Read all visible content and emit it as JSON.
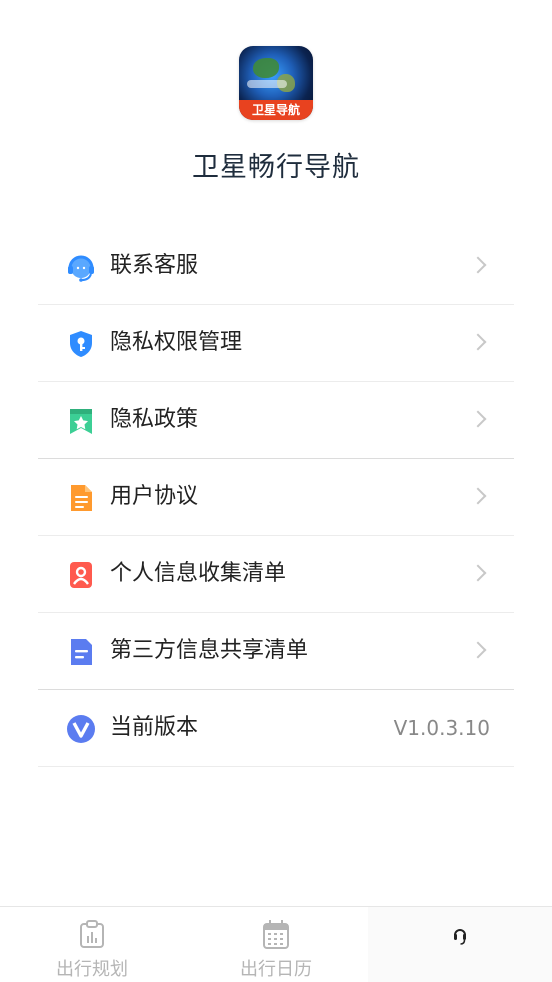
{
  "app": {
    "name": "卫星畅行导航",
    "logo_text": "卫星导航"
  },
  "menu": [
    {
      "label": "联系客服",
      "icon": "headset-support-icon",
      "color": "#2f8cff"
    },
    {
      "label": "隐私权限管理",
      "icon": "shield-key-icon",
      "color": "#2f8cff"
    },
    {
      "label": "隐私政策",
      "icon": "bookmark-star-icon",
      "color": "#2ec28b"
    },
    {
      "label": "用户协议",
      "icon": "document-lines-icon",
      "color": "#ff8a1f"
    },
    {
      "label": "个人信息收集清单",
      "icon": "person-card-icon",
      "color": "#ff5a4e"
    },
    {
      "label": "第三方信息共享清单",
      "icon": "document-icon",
      "color": "#5b7cf0"
    },
    {
      "label": "当前版本",
      "icon": "version-v-icon",
      "color": "#5b7cf0",
      "value": "V1.0.3.10"
    }
  ],
  "tabbar": {
    "tabs": [
      {
        "label": "出行规划",
        "icon": "clipboard-chart-icon"
      },
      {
        "label": "出行日历",
        "icon": "calendar-icon"
      },
      {
        "label": "",
        "icon": "headset-icon",
        "active": true
      }
    ]
  }
}
